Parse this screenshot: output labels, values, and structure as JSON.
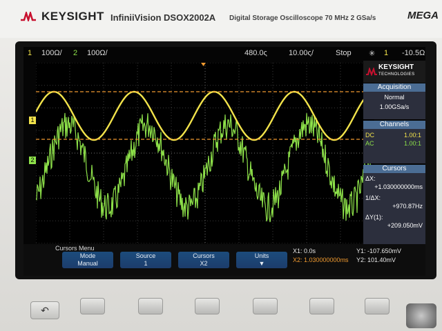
{
  "header": {
    "brand": "KEYSIGHT",
    "model": "InfiniiVision DSOX2002A",
    "description": "Digital Storage Oscilloscope  70 MHz  2 GSa/s",
    "series": "MEGA"
  },
  "status_bar": {
    "ch1_num": "1",
    "ch1_scale": "100Ω/",
    "ch2_num": "2",
    "ch2_scale": "100Ω/",
    "time_position": "480.0ς",
    "time_scale": "10.00ς/",
    "run_state": "Stop",
    "trigger_symbol": "✳",
    "trigger_source": "1",
    "trigger_level": "-10.5Ω"
  },
  "right_panel": {
    "logo_brand": "KEYSIGHT",
    "logo_sub": "TECHNOLOGIES",
    "acquisition": {
      "header": "Acquisition",
      "mode": "Normal",
      "rate": "1.00GSa/s"
    },
    "channels": {
      "header": "Channels",
      "ch1_coupling": "DC",
      "ch1_probe": "1.00:1",
      "ch2_coupling": "AC",
      "ch2_probe": "1.00:1"
    },
    "cursors": {
      "header": "Cursors",
      "dx_label": "ΔX:",
      "dx_value": "+1.030000000ms",
      "inv_dx_label": "1/ΔX:",
      "inv_dx_value": "+970.87Hz",
      "dy_label": "ΔY(1):",
      "dy_value": "+209.050mV"
    }
  },
  "menu": {
    "title": "Cursors Menu",
    "softkeys": [
      {
        "top": "Mode",
        "bottom": "Manual"
      },
      {
        "top": "Source",
        "bottom": "1"
      },
      {
        "top": "Cursors",
        "bottom": "X2"
      },
      {
        "top": "Units",
        "bottom": "▼"
      }
    ],
    "readouts": {
      "x1": "X1: 0.0s",
      "x2": "X2: 1.030000000ms",
      "y1": "Y1: -107.650mV",
      "y2": "Y2: 101.40mV"
    }
  },
  "markers": {
    "ch1": "1",
    "ch2": "2"
  },
  "colors": {
    "ch1": "#f2e34b",
    "ch2": "#8ee24a",
    "cursor": "#f09a30",
    "panel_header": "#4b6d94",
    "softkey": "#1c4c7c"
  },
  "icons": {
    "back": "back-arrow-icon",
    "trigger": "trigger-edge-icon",
    "brand_logo": "keysight-wave-icon"
  }
}
